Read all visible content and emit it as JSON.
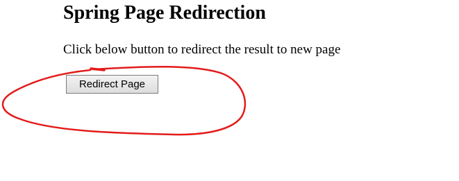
{
  "page": {
    "title": "Spring Page Redirection",
    "description": "Click below button to redirect the result to new page",
    "redirect_button_label": "Redirect Page"
  },
  "colors": {
    "annotation_stroke": "#e31b1b"
  }
}
